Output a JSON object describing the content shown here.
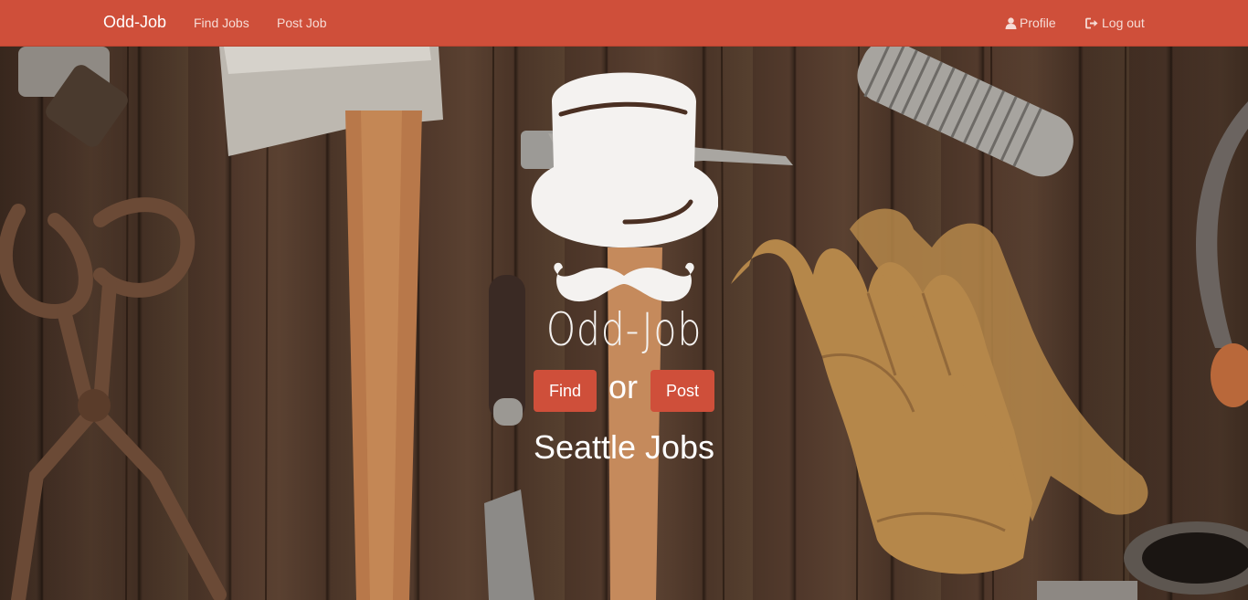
{
  "nav": {
    "brand": "Odd-Job",
    "find_jobs": "Find Jobs",
    "post_job": "Post Job",
    "profile": "Profile",
    "logout": "Log out"
  },
  "hero": {
    "title": "Odd-Job",
    "find_button": "Find",
    "or_text": "or",
    "post_button": "Post",
    "city": "Seattle Jobs",
    "logo_icon": "top-hat-mustache-icon"
  },
  "colors": {
    "brand": "#cf4f3a",
    "text_light": "#ffffff",
    "logo": "#f4f2f0"
  }
}
